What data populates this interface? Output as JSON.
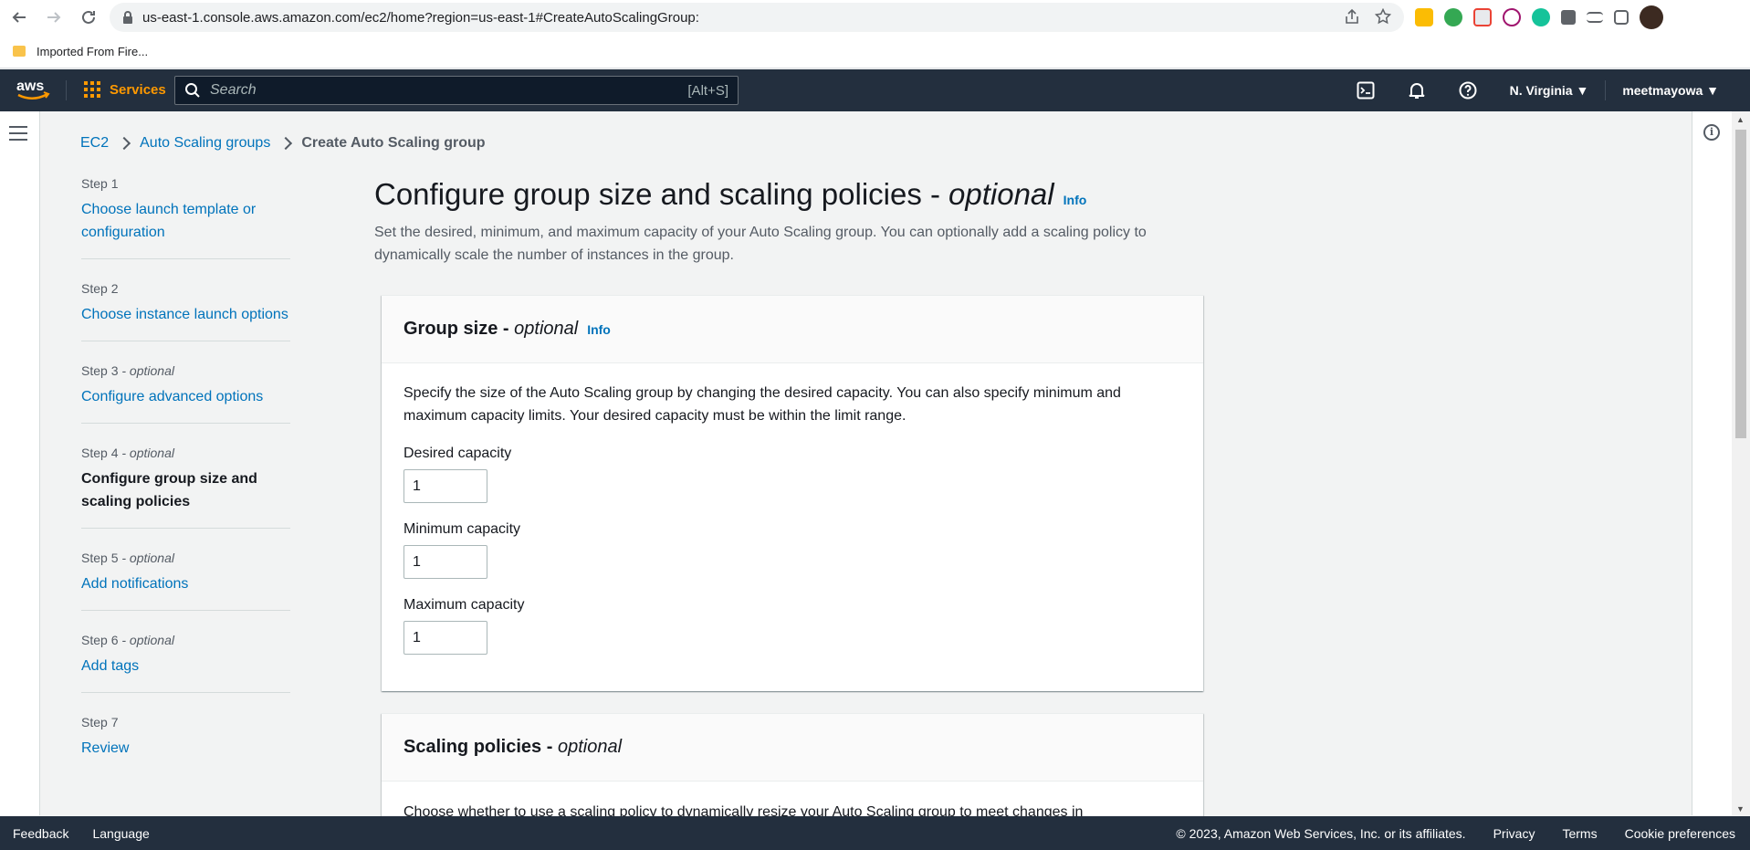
{
  "browser": {
    "url": "us-east-1.console.aws.amazon.com/ec2/home?region=us-east-1#CreateAutoScalingGroup:",
    "bookmark": "Imported From Fire..."
  },
  "header": {
    "services_label": "Services",
    "search_placeholder": "Search",
    "search_shortcut": "[Alt+S]",
    "region": "N. Virginia ▼",
    "account": "meetmayowa ▼"
  },
  "breadcrumb": {
    "items": [
      "EC2",
      "Auto Scaling groups"
    ],
    "current": "Create Auto Scaling group"
  },
  "steps": [
    {
      "num": "Step 1",
      "optional": "",
      "title": "Choose launch template or configuration"
    },
    {
      "num": "Step 2",
      "optional": "",
      "title": "Choose instance launch options"
    },
    {
      "num": "Step 3",
      "optional": " - optional",
      "title": "Configure advanced options"
    },
    {
      "num": "Step 4",
      "optional": " - optional",
      "title": "Configure group size and scaling policies"
    },
    {
      "num": "Step 5",
      "optional": " - optional",
      "title": "Add notifications"
    },
    {
      "num": "Step 6",
      "optional": " - optional",
      "title": "Add tags"
    },
    {
      "num": "Step 7",
      "optional": "",
      "title": "Review"
    }
  ],
  "page": {
    "title": "Configure group size and scaling policies -",
    "title_optional": "optional",
    "info": "Info",
    "description": "Set the desired, minimum, and maximum capacity of your Auto Scaling group. You can optionally add a scaling policy to dynamically scale the number of instances in the group."
  },
  "group_size": {
    "title": "Group size -",
    "title_optional": "optional",
    "info": "Info",
    "description": "Specify the size of the Auto Scaling group by changing the desired capacity. You can also specify minimum and maximum capacity limits. Your desired capacity must be within the limit range.",
    "desired_label": "Desired capacity",
    "desired_value": "1",
    "min_label": "Minimum capacity",
    "min_value": "1",
    "max_label": "Maximum capacity",
    "max_value": "1"
  },
  "scaling_policies": {
    "title": "Scaling policies -",
    "title_optional": "optional",
    "description": "Choose whether to use a scaling policy to dynamically resize your Auto Scaling group to meet changes in"
  },
  "footer": {
    "feedback": "Feedback",
    "language": "Language",
    "copyright": "© 2023, Amazon Web Services, Inc. or its affiliates.",
    "privacy": "Privacy",
    "terms": "Terms",
    "cookies": "Cookie preferences"
  },
  "colors": {
    "aws_orange": "#ff9900",
    "header_bg": "#232f3e",
    "link": "#0073bb"
  }
}
